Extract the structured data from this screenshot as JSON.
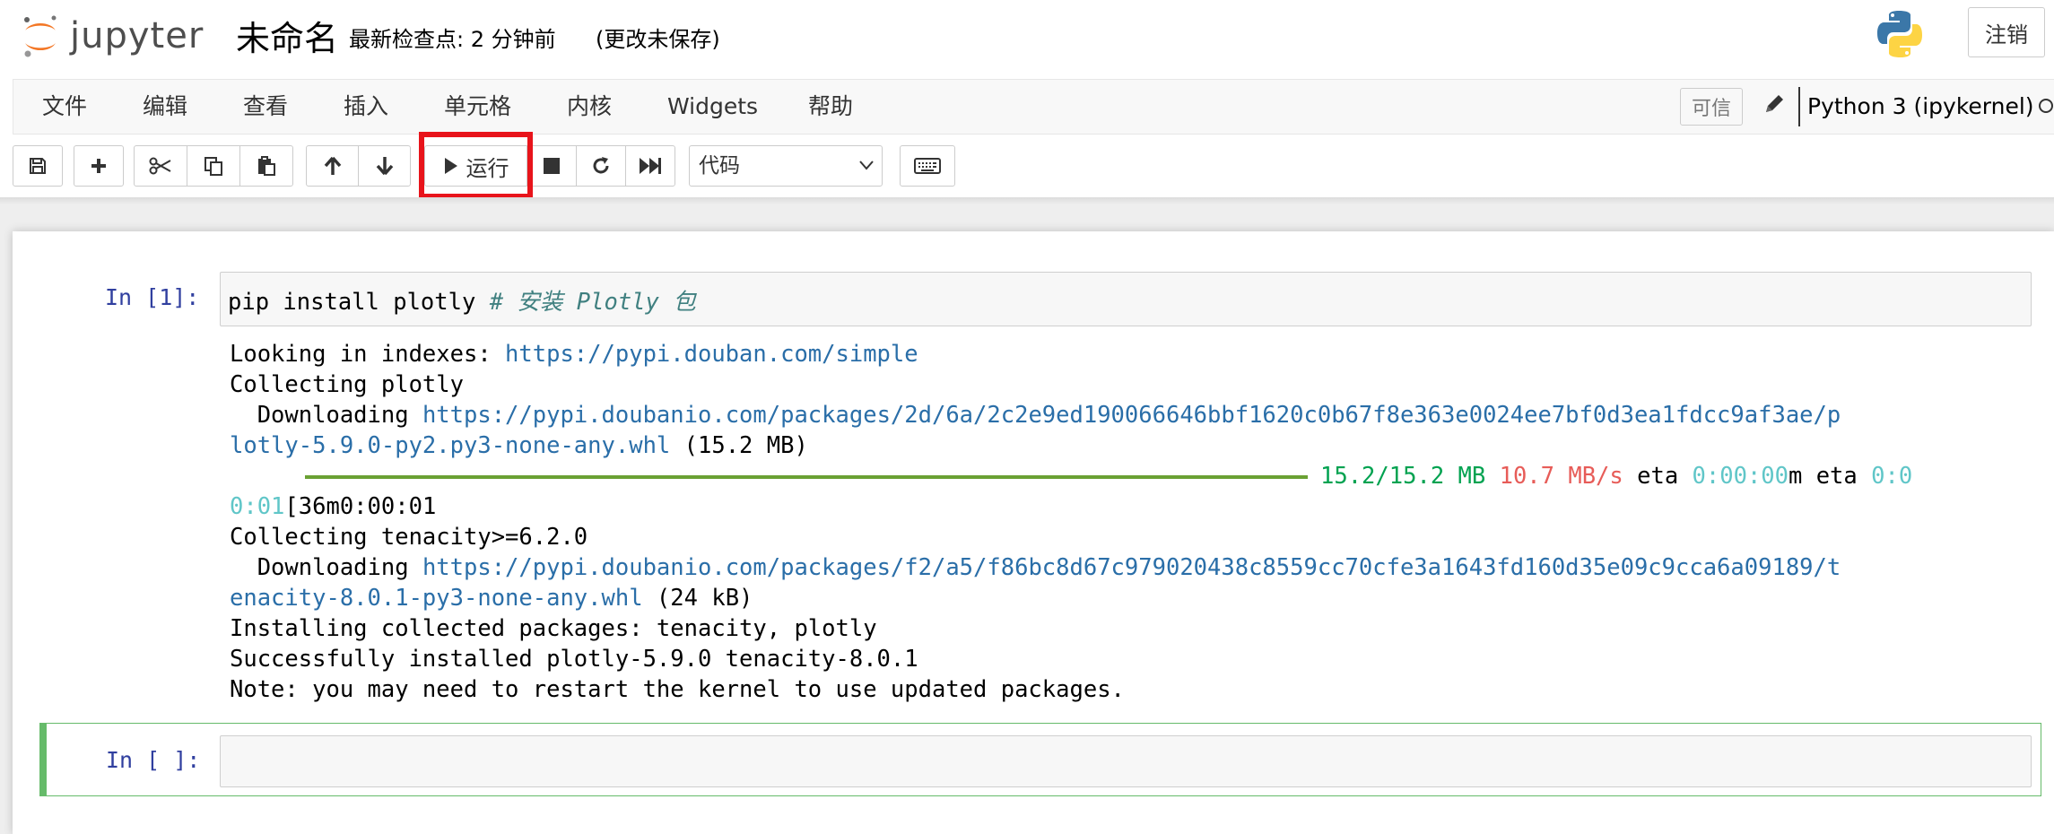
{
  "header": {
    "logo_text": "jupyter",
    "notebook_title": "未命名",
    "checkpoint": "最新检查点: 2 分钟前",
    "unsaved": "(更改未保存)",
    "logout_label": "注销"
  },
  "menubar": {
    "items": [
      "文件",
      "编辑",
      "查看",
      "插入",
      "单元格",
      "内核",
      "Widgets",
      "帮助"
    ],
    "trusted_label": "可信",
    "kernel_name": "Python 3 (ipykernel)"
  },
  "toolbar": {
    "run_label": "运行",
    "cell_type": "代码",
    "highlight_color": "#e8141b"
  },
  "cells": [
    {
      "prompt": "In [1]:",
      "code": "pip install plotly ",
      "comment": "# 安装 Plotly 包",
      "output": {
        "line1_text": "Looking in indexes: ",
        "line1_link": "https://pypi.douban.com/simple",
        "line2": "Collecting plotly",
        "line3_text": "  Downloading ",
        "line3_link": "https://pypi.doubanio.com/packages/2d/6a/2c2e9ed190066646bbf1620c0b67f8e363e0024ee7bf0d3ea1fdcc9af3ae/p",
        "line4_link": "lotly-5.9.0-py2.py3-none-any.whl",
        "line4_text": " (15.2 MB)",
        "progress_size": "15.2/15.2 MB",
        "progress_speed": "10.7 MB/s",
        "progress_eta_label": " eta ",
        "progress_eta": "0:00:00",
        "progress_tail": "m eta ",
        "progress_eta2": "0:0",
        "line6_cyan": "0:01",
        "line6_text": "[36m0:00:01",
        "line7": "Collecting tenacity>=6.2.0",
        "line8_text": "  Downloading ",
        "line8_link": "https://pypi.doubanio.com/packages/f2/a5/f86bc8d67c979020438c8559cc70cfe3a1643fd160d35e09c9cca6a09189/t",
        "line9_link": "enacity-8.0.1-py3-none-any.whl",
        "line9_text": " (24 kB)",
        "line10": "Installing collected packages: tenacity, plotly",
        "line11": "Successfully installed plotly-5.9.0 tenacity-8.0.1",
        "line12": "Note: you may need to restart the kernel to use updated packages."
      }
    },
    {
      "prompt": "In [ ]:",
      "code": ""
    }
  ]
}
